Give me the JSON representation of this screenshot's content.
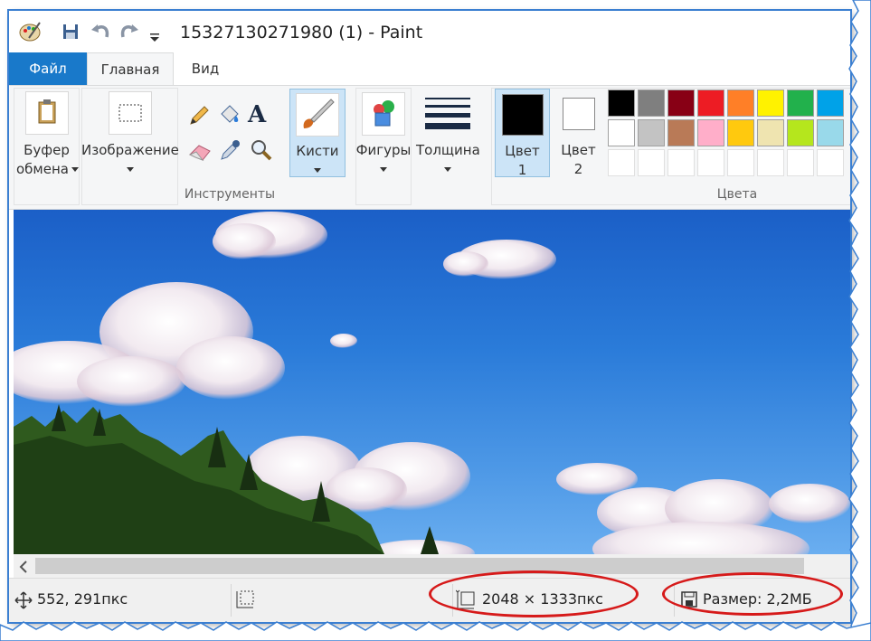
{
  "window": {
    "title": "15327130271980 (1) - Paint"
  },
  "menu": {
    "file": "Файл",
    "home": "Главная",
    "view": "Вид"
  },
  "ribbon": {
    "clipboard": {
      "line1": "Буфер",
      "line2": "обмена"
    },
    "image": {
      "label": "Изображение"
    },
    "tools": {
      "group_label": "Инструменты"
    },
    "brushes": {
      "label": "Кисти"
    },
    "shapes": {
      "label": "Фигуры"
    },
    "thickness": {
      "label": "Толщина"
    },
    "color1": {
      "line1": "Цвет",
      "line2": "1"
    },
    "color2": {
      "line1": "Цвет",
      "line2": "2"
    },
    "colors": {
      "group_label": "Цвета",
      "row1": [
        "#000000",
        "#7f7f7f",
        "#880015",
        "#ed1c24",
        "#ff7f27",
        "#fff200",
        "#22b14c",
        "#00a2e8"
      ],
      "row2": [
        "#ffffff",
        "#c3c3c3",
        "#b97a57",
        "#ffaec9",
        "#ffc90e",
        "#efe4b0",
        "#b5e61d",
        "#99d9ea"
      ],
      "row3_empty_count": 8
    },
    "color1_value": "#000000",
    "color2_value": "#ffffff"
  },
  "status": {
    "cursor_pos": "552, 291пкс",
    "image_size": "2048 × 1333пкс",
    "file_size": "Размер: 2,2МБ"
  },
  "colors": {
    "accent": "#1979ca",
    "annotation": "#d61a1a",
    "ribbon_bg": "#f5f6f7",
    "selected_bg": "#cce4f7"
  }
}
